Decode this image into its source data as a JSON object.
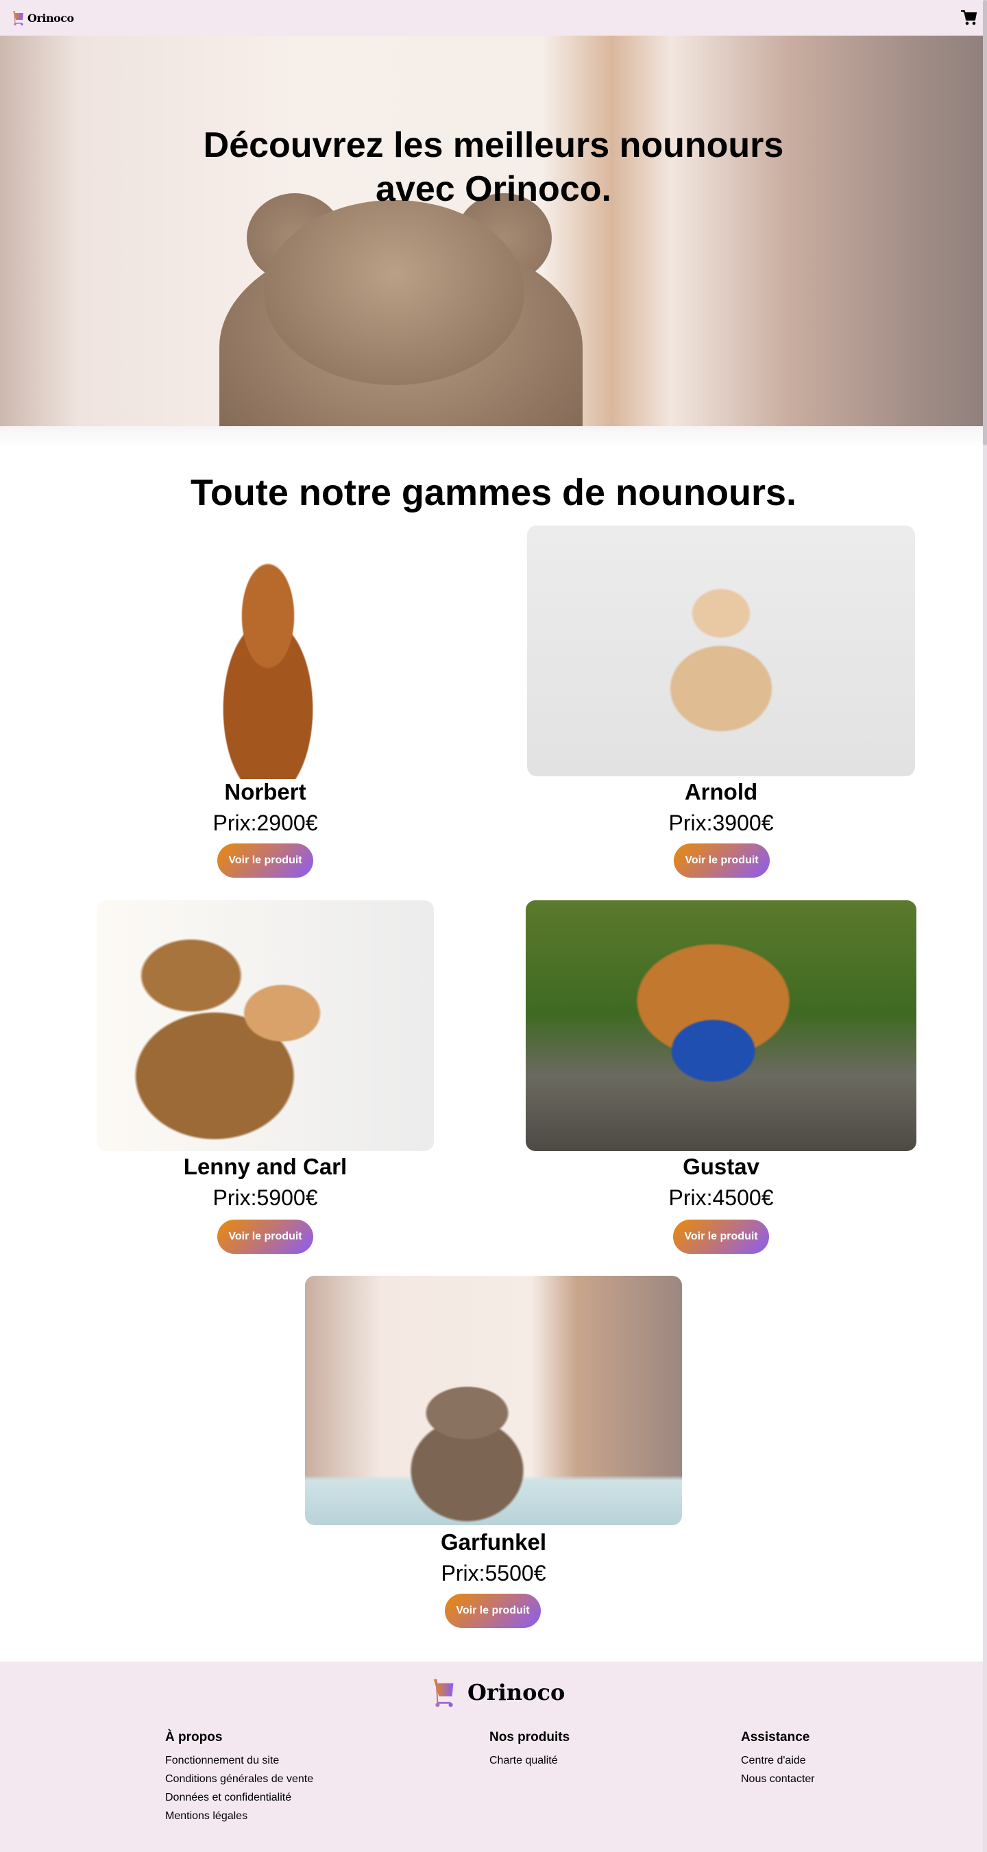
{
  "header": {
    "brand": "Orinoco"
  },
  "hero": {
    "title_line1": "Découvrez les meilleurs nounours",
    "title_line2": "avec Orinoco."
  },
  "catalog": {
    "title": "Toute notre gammes de nounours.",
    "products": [
      {
        "name": "Norbert",
        "price": "Prix:2900€",
        "button": "Voir le produit"
      },
      {
        "name": "Arnold",
        "price": "Prix:3900€",
        "button": "Voir le produit"
      },
      {
        "name": "Lenny and Carl",
        "price": "Prix:5900€",
        "button": "Voir le produit"
      },
      {
        "name": "Gustav",
        "price": "Prix:4500€",
        "button": "Voir le produit"
      },
      {
        "name": "Garfunkel",
        "price": "Prix:5500€",
        "button": "Voir le produit"
      }
    ]
  },
  "footer": {
    "brand": "Orinoco",
    "columns": [
      {
        "title": "À propos",
        "links": [
          "Fonctionnement du site",
          "Conditions générales de vente",
          "Données et confidentialité",
          "Mentions légales"
        ]
      },
      {
        "title": "Nos produits",
        "links": [
          "Charte qualité"
        ]
      },
      {
        "title": "Assistance",
        "links": [
          "Centre d'aide",
          "Nous contacter"
        ]
      }
    ]
  },
  "colors": {
    "accent_start": "#e88b0c",
    "accent_end": "#8b5cf6",
    "header_bg": "#f3e8f0"
  }
}
